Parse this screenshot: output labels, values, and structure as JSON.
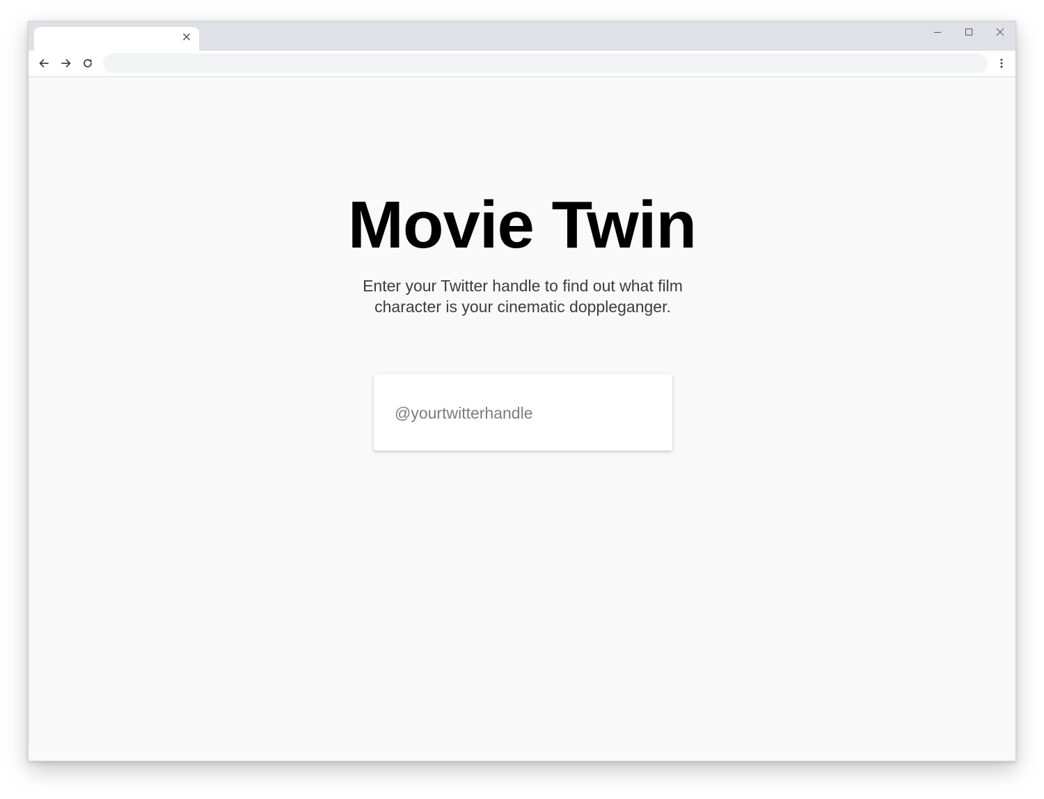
{
  "browser": {
    "tab": {
      "title": "",
      "close_icon": "close-icon"
    },
    "address_bar": {
      "value": "",
      "placeholder": ""
    },
    "nav": {
      "back_icon": "arrow-left-icon",
      "forward_icon": "arrow-right-icon",
      "reload_icon": "reload-icon",
      "menu_icon": "kebab-menu-icon"
    },
    "window_controls": [
      "minimize-icon",
      "maximize-icon",
      "close-icon"
    ]
  },
  "page": {
    "title": "Movie Twin",
    "subtitle": "Enter your Twitter handle to find out what film character is your cinematic doppleganger.",
    "handle_input": {
      "value": "",
      "placeholder": "@yourtwitterhandle"
    }
  },
  "colors": {
    "page_background": "#f9f9f9",
    "title_text": "#000000",
    "subtitle_text": "#3c3c3c",
    "placeholder_text": "#7d7d7d",
    "titlebar": "#dee1e6"
  }
}
